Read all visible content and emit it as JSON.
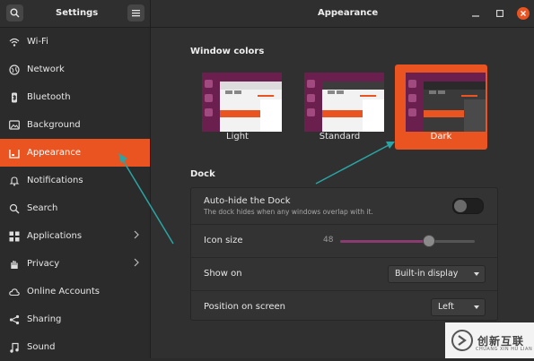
{
  "header": {
    "sidebar_title": "Settings",
    "page_title": "Appearance"
  },
  "sidebar": {
    "items": [
      {
        "label": "Wi-Fi",
        "icon": "wifi-icon"
      },
      {
        "label": "Network",
        "icon": "network-icon"
      },
      {
        "label": "Bluetooth",
        "icon": "bluetooth-icon"
      },
      {
        "label": "Background",
        "icon": "background-icon"
      },
      {
        "label": "Appearance",
        "icon": "appearance-icon",
        "active": true
      },
      {
        "label": "Notifications",
        "icon": "bell-icon"
      },
      {
        "label": "Search",
        "icon": "search-icon"
      },
      {
        "label": "Applications",
        "icon": "grid-icon",
        "chevron": true
      },
      {
        "label": "Privacy",
        "icon": "hand-icon",
        "chevron": true
      },
      {
        "label": "Online Accounts",
        "icon": "cloud-icon"
      },
      {
        "label": "Sharing",
        "icon": "share-icon"
      },
      {
        "label": "Sound",
        "icon": "music-note-icon"
      }
    ]
  },
  "window_colors": {
    "title": "Window colors",
    "options": [
      {
        "label": "Light",
        "selected": false
      },
      {
        "label": "Standard",
        "selected": false
      },
      {
        "label": "Dark",
        "selected": true
      }
    ]
  },
  "dock": {
    "title": "Dock",
    "autohide": {
      "label": "Auto-hide the Dock",
      "description": "The dock hides when any windows overlap with it.",
      "enabled": false
    },
    "icon_size": {
      "label": "Icon size",
      "value": "48",
      "level": 0.66
    },
    "show_on": {
      "label": "Show on",
      "value": "Built-in display"
    },
    "position": {
      "label": "Position on screen",
      "value": "Left"
    }
  },
  "watermark": {
    "text": "创新互联",
    "subtext": "CHUANG XIN HU LIAN"
  },
  "colors": {
    "accent": "#e95420",
    "annotation_arrow": "#2aa5a5",
    "slider_fill": "#8a3b6f"
  }
}
